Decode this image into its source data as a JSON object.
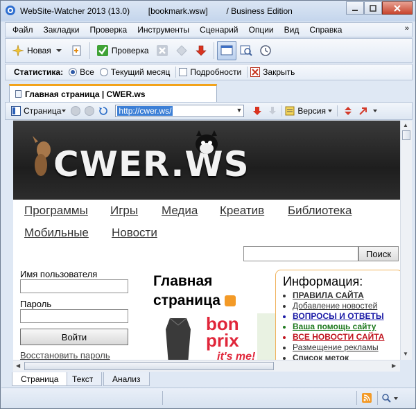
{
  "window": {
    "title": "WebSite-Watcher 2013 (13.0)        [bookmark.wsw]        / Business Edition"
  },
  "menu": {
    "items": [
      "Файл",
      "Закладки",
      "Проверка",
      "Инструменты",
      "Сценарий",
      "Опции",
      "Вид",
      "Справка"
    ],
    "more": "»"
  },
  "toolbar": {
    "new_label": "Новая",
    "check_label": "Проверка"
  },
  "stats": {
    "label": "Статистика:",
    "all": "Все",
    "current_month": "Текущий месяц",
    "details": "Подробности",
    "close": "Закрыть"
  },
  "doc_tab": {
    "title": "Главная страница | CWER.ws"
  },
  "addressbar": {
    "page_label": "Страница",
    "url": "http://cwer.ws/",
    "version_label": "Версия"
  },
  "site": {
    "logo": "CWER.WS",
    "nav": [
      "Программы",
      "Игры",
      "Медиа",
      "Креатив",
      "Библиотека",
      "Мобильные",
      "Новости"
    ],
    "search_button": "Поиск",
    "username_label": "Имя пользователя",
    "password_label": "Пароль",
    "login_button": "Войти",
    "restore_link": "Восстановить пароль",
    "main_title_line1": "Главная",
    "main_title_line2": "страница",
    "ad_text1": "bon",
    "ad_text2": "prix",
    "ad_text3": "it's me!",
    "info": {
      "title": "Информация:",
      "items": [
        {
          "text": "ПРАВИЛА САЙТА",
          "color": "#333333",
          "bold": true
        },
        {
          "text": "Добавление новостей",
          "color": "#333333",
          "bold": false
        },
        {
          "text": "ВОПРОСЫ И ОТВЕТЫ",
          "color": "#1a1aa6",
          "bold": true
        },
        {
          "text": "Ваша помощь сайту",
          "color": "#1f7a1f",
          "bold": true
        },
        {
          "text": "ВСЕ НОВОСТИ САЙТА",
          "color": "#c0141e",
          "bold": true
        },
        {
          "text": "Размещение рекламы",
          "color": "#333333",
          "bold": false
        },
        {
          "text": "Список меток",
          "color": "#333333",
          "bold": true
        }
      ]
    }
  },
  "bottom_tabs": [
    "Страница",
    "Текст",
    "Анализ"
  ]
}
